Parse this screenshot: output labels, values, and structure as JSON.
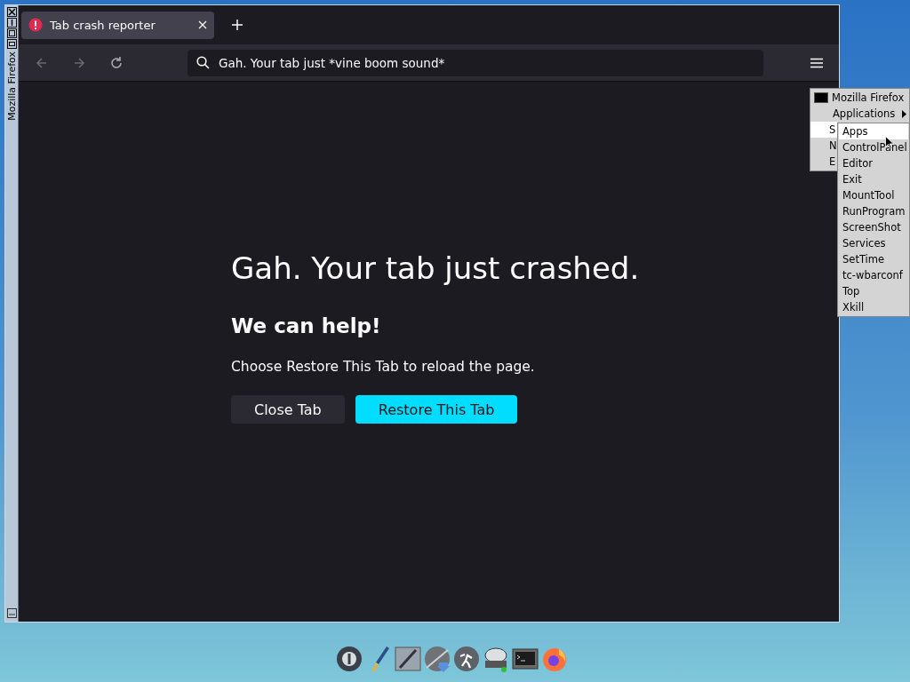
{
  "window": {
    "title": "Mozilla Firefox"
  },
  "tabs": [
    {
      "title": "Tab crash reporter",
      "selected": true
    }
  ],
  "nav": [
    {
      "kind": "back",
      "disabled": true
    },
    {
      "kind": "forward",
      "disabled": true
    },
    {
      "kind": "reload",
      "disabled": false
    }
  ],
  "address_bar": {
    "value": "Gah. Your tab just *vine boom sound*"
  },
  "page": {
    "heading": "Gah. Your tab just crashed.",
    "subheading": "We can help!",
    "message": "Choose Restore This Tab to reload the page.",
    "buttons": [
      {
        "label": "Close Tab",
        "kind": "secondary"
      },
      {
        "label": "Restore This Tab",
        "kind": "primary"
      }
    ]
  },
  "menu": {
    "items": [
      {
        "label": "Mozilla Firefox",
        "kind": "window",
        "selected": false
      },
      {
        "label": "Applications",
        "kind": "submenu",
        "selected": false
      },
      {
        "label": "S",
        "kind": "item",
        "selected": true
      },
      {
        "label": "N",
        "kind": "item",
        "selected": false
      },
      {
        "label": "E",
        "kind": "item",
        "selected": false
      }
    ],
    "submenu": [
      {
        "label": "Apps",
        "selected": true
      },
      {
        "label": "ControlPanel",
        "selected": false
      },
      {
        "label": "Editor",
        "selected": false
      },
      {
        "label": "Exit",
        "selected": false
      },
      {
        "label": "MountTool",
        "selected": false
      },
      {
        "label": "RunProgram",
        "selected": false
      },
      {
        "label": "ScreenShot",
        "selected": false
      },
      {
        "label": "Services",
        "selected": false
      },
      {
        "label": "SetTime",
        "selected": false
      },
      {
        "label": "tc-wbarconf",
        "selected": false
      },
      {
        "label": "Top",
        "selected": false
      },
      {
        "label": "Xkill",
        "selected": false
      }
    ]
  }
}
